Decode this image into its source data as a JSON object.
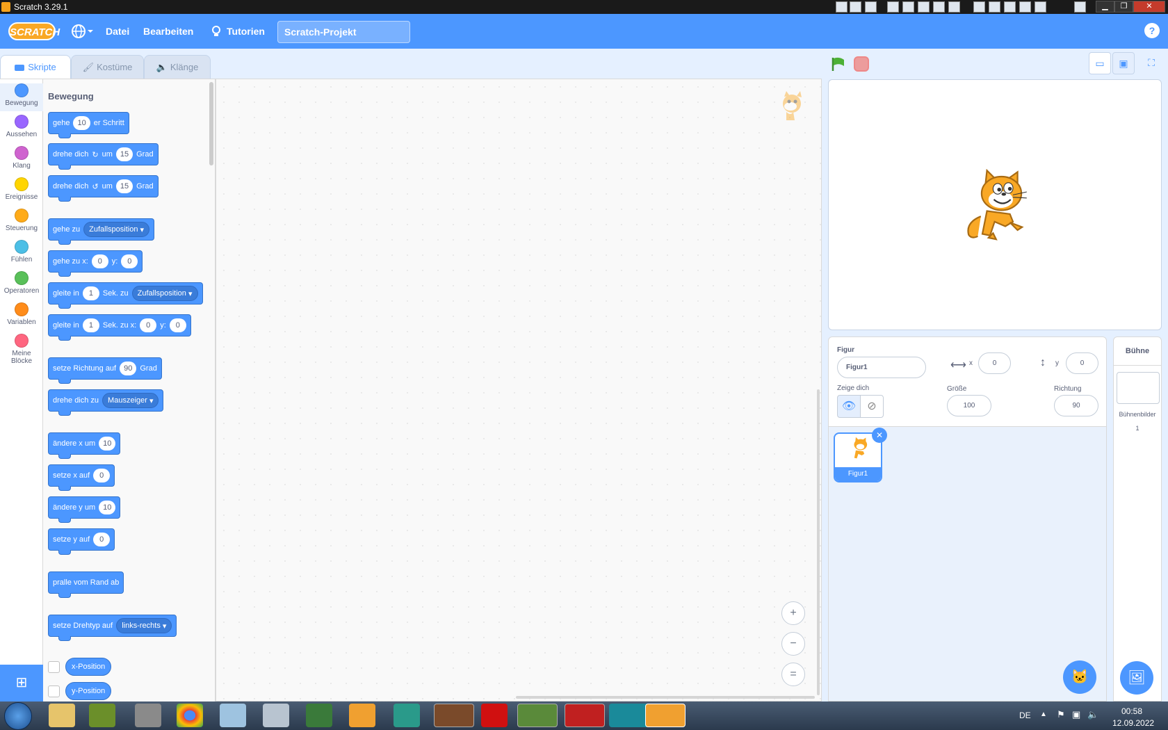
{
  "window": {
    "title": "Scratch 3.29.1"
  },
  "menu": {
    "logo": "SCRATCH",
    "file": "Datei",
    "edit": "Bearbeiten",
    "tutorials": "Tutorien",
    "project_title": "Scratch-Projekt",
    "help": "?"
  },
  "tabs": [
    {
      "label": "Skripte",
      "active": true
    },
    {
      "label": "Kostüme",
      "active": false
    },
    {
      "label": "Klänge",
      "active": false
    }
  ],
  "categories": [
    {
      "label": "Bewegung",
      "color": "#4c97ff"
    },
    {
      "label": "Aussehen",
      "color": "#9966ff"
    },
    {
      "label": "Klang",
      "color": "#cf63cf"
    },
    {
      "label": "Ereignisse",
      "color": "#ffd500"
    },
    {
      "label": "Steuerung",
      "color": "#ffab19"
    },
    {
      "label": "Fühlen",
      "color": "#4cbfe6"
    },
    {
      "label": "Operatoren",
      "color": "#59c059"
    },
    {
      "label": "Variablen",
      "color": "#ff8c1a"
    },
    {
      "label": "Meine Blöcke",
      "color": "#ff6680"
    }
  ],
  "palette": {
    "heading": "Bewegung",
    "blocks": {
      "move": {
        "a": "gehe",
        "v": "10",
        "b": "er Schritt"
      },
      "turn_right": {
        "a": "drehe dich",
        "b": "um",
        "v": "15",
        "c": "Grad"
      },
      "turn_left": {
        "a": "drehe dich",
        "b": "um",
        "v": "15",
        "c": "Grad"
      },
      "goto": {
        "a": "gehe zu",
        "d": "Zufallsposition"
      },
      "goto_xy": {
        "a": "gehe zu x:",
        "x": "0",
        "b": "y:",
        "y": "0"
      },
      "glide_to": {
        "a": "gleite in",
        "v": "1",
        "b": "Sek. zu",
        "d": "Zufallsposition"
      },
      "glide_xy": {
        "a": "gleite in",
        "v": "1",
        "b": "Sek. zu x:",
        "x": "0",
        "c": "y:",
        "y": "0"
      },
      "point_dir": {
        "a": "setze Richtung auf",
        "v": "90",
        "b": "Grad"
      },
      "point_towards": {
        "a": "drehe dich zu",
        "d": "Mauszeiger"
      },
      "change_x": {
        "a": "ändere x um",
        "v": "10"
      },
      "set_x": {
        "a": "setze x auf",
        "v": "0"
      },
      "change_y": {
        "a": "ändere y um",
        "v": "10"
      },
      "set_y": {
        "a": "setze y auf",
        "v": "0"
      },
      "bounce": {
        "a": "pralle vom Rand ab"
      },
      "rotation": {
        "a": "setze Drehtyp auf",
        "d": "links-rechts"
      },
      "x_pos": "x-Position",
      "y_pos": "y-Position"
    }
  },
  "zoom": {
    "in": "+",
    "out": "−",
    "reset": "="
  },
  "sprite_info": {
    "sprite_label": "Figur",
    "sprite_name": "Figur1",
    "x_label": "x",
    "x_value": "0",
    "y_label": "y",
    "y_value": "0",
    "show_label": "Zeige dich",
    "size_label": "Größe",
    "size_value": "100",
    "direction_label": "Richtung",
    "direction_value": "90"
  },
  "sprites": [
    {
      "name": "Figur1",
      "selected": true
    }
  ],
  "stage_panel": {
    "title": "Bühne",
    "backdrops_label": "Bühnenbilder",
    "backdrops_count": "1"
  },
  "taskbar": {
    "lang": "DE",
    "time": "00:58",
    "date": "12.09.2022"
  }
}
